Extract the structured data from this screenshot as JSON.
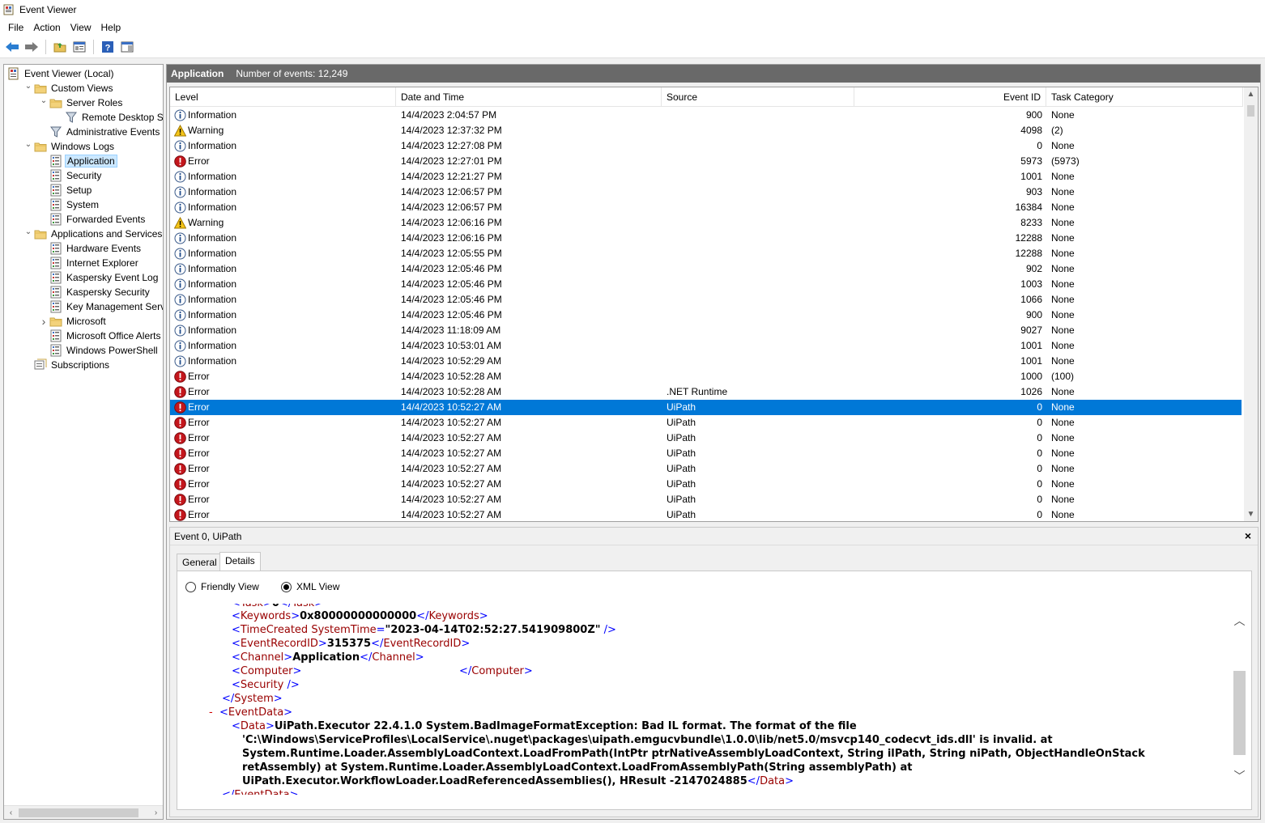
{
  "window": {
    "title": "Event Viewer"
  },
  "menu": [
    "File",
    "Action",
    "View",
    "Help"
  ],
  "toolbar": {
    "buttons": [
      "back-arrow-icon",
      "forward-arrow-icon",
      "open-folder-icon",
      "properties-icon",
      "help-icon",
      "show-hide-pane-icon"
    ]
  },
  "tree": {
    "items": [
      {
        "label": "Event Viewer (Local)",
        "depth": 0,
        "expander": "",
        "icon": "event-viewer-icon"
      },
      {
        "label": "Custom Views",
        "depth": 1,
        "expander": "open",
        "icon": "folder-icon"
      },
      {
        "label": "Server Roles",
        "depth": 2,
        "expander": "open",
        "icon": "folder-icon"
      },
      {
        "label": "Remote Desktop Serv",
        "depth": 3,
        "expander": "",
        "icon": "filter-icon"
      },
      {
        "label": "Administrative Events",
        "depth": 2,
        "expander": "",
        "icon": "filter-icon"
      },
      {
        "label": "Windows Logs",
        "depth": 1,
        "expander": "open",
        "icon": "folder-icon"
      },
      {
        "label": "Application",
        "depth": 2,
        "expander": "",
        "icon": "log-icon",
        "selected": true
      },
      {
        "label": "Security",
        "depth": 2,
        "expander": "",
        "icon": "log-icon"
      },
      {
        "label": "Setup",
        "depth": 2,
        "expander": "",
        "icon": "log-icon"
      },
      {
        "label": "System",
        "depth": 2,
        "expander": "",
        "icon": "log-icon"
      },
      {
        "label": "Forwarded Events",
        "depth": 2,
        "expander": "",
        "icon": "log-icon"
      },
      {
        "label": "Applications and Services Lo",
        "depth": 1,
        "expander": "open",
        "icon": "folder-icon"
      },
      {
        "label": "Hardware Events",
        "depth": 2,
        "expander": "",
        "icon": "log-icon"
      },
      {
        "label": "Internet Explorer",
        "depth": 2,
        "expander": "",
        "icon": "log-icon"
      },
      {
        "label": "Kaspersky Event Log",
        "depth": 2,
        "expander": "",
        "icon": "log-icon"
      },
      {
        "label": "Kaspersky Security",
        "depth": 2,
        "expander": "",
        "icon": "log-icon"
      },
      {
        "label": "Key Management Service",
        "depth": 2,
        "expander": "",
        "icon": "log-icon"
      },
      {
        "label": "Microsoft",
        "depth": 2,
        "expander": "closed",
        "icon": "folder-icon"
      },
      {
        "label": "Microsoft Office Alerts",
        "depth": 2,
        "expander": "",
        "icon": "log-icon"
      },
      {
        "label": "Windows PowerShell",
        "depth": 2,
        "expander": "",
        "icon": "log-icon"
      },
      {
        "label": "Subscriptions",
        "depth": 1,
        "expander": "",
        "icon": "subscriptions-icon"
      }
    ]
  },
  "main": {
    "title": "Application",
    "count_text": "Number of events: 12,249"
  },
  "columns": [
    "Level",
    "Date and Time",
    "Source",
    "Event ID",
    "Task Category"
  ],
  "events": [
    {
      "level": "Information",
      "datetime": "14/4/2023 2:04:57 PM",
      "source": "",
      "id": "900",
      "task": "None"
    },
    {
      "level": "Warning",
      "datetime": "14/4/2023 12:37:32 PM",
      "source": "",
      "id": "4098",
      "task": "(2)"
    },
    {
      "level": "Information",
      "datetime": "14/4/2023 12:27:08 PM",
      "source": "",
      "id": "0",
      "task": "None"
    },
    {
      "level": "Error",
      "datetime": "14/4/2023 12:27:01 PM",
      "source": "",
      "id": "5973",
      "task": "(5973)"
    },
    {
      "level": "Information",
      "datetime": "14/4/2023 12:21:27 PM",
      "source": "",
      "id": "1001",
      "task": "None"
    },
    {
      "level": "Information",
      "datetime": "14/4/2023 12:06:57 PM",
      "source": "",
      "id": "903",
      "task": "None"
    },
    {
      "level": "Information",
      "datetime": "14/4/2023 12:06:57 PM",
      "source": "",
      "id": "16384",
      "task": "None"
    },
    {
      "level": "Warning",
      "datetime": "14/4/2023 12:06:16 PM",
      "source": "",
      "id": "8233",
      "task": "None"
    },
    {
      "level": "Information",
      "datetime": "14/4/2023 12:06:16 PM",
      "source": "",
      "id": "12288",
      "task": "None"
    },
    {
      "level": "Information",
      "datetime": "14/4/2023 12:05:55 PM",
      "source": "",
      "id": "12288",
      "task": "None"
    },
    {
      "level": "Information",
      "datetime": "14/4/2023 12:05:46 PM",
      "source": "",
      "id": "902",
      "task": "None"
    },
    {
      "level": "Information",
      "datetime": "14/4/2023 12:05:46 PM",
      "source": "",
      "id": "1003",
      "task": "None"
    },
    {
      "level": "Information",
      "datetime": "14/4/2023 12:05:46 PM",
      "source": "",
      "id": "1066",
      "task": "None"
    },
    {
      "level": "Information",
      "datetime": "14/4/2023 12:05:46 PM",
      "source": "",
      "id": "900",
      "task": "None"
    },
    {
      "level": "Information",
      "datetime": "14/4/2023 11:18:09 AM",
      "source": "",
      "id": "9027",
      "task": "None"
    },
    {
      "level": "Information",
      "datetime": "14/4/2023 10:53:01 AM",
      "source": "",
      "id": "1001",
      "task": "None"
    },
    {
      "level": "Information",
      "datetime": "14/4/2023 10:52:29 AM",
      "source": "",
      "id": "1001",
      "task": "None"
    },
    {
      "level": "Error",
      "datetime": "14/4/2023 10:52:28 AM",
      "source": "",
      "id": "1000",
      "task": "(100)"
    },
    {
      "level": "Error",
      "datetime": "14/4/2023 10:52:28 AM",
      "source": ".NET Runtime",
      "id": "1026",
      "task": "None"
    },
    {
      "level": "Error",
      "datetime": "14/4/2023 10:52:27 AM",
      "source": "UiPath",
      "id": "0",
      "task": "None",
      "selected": true
    },
    {
      "level": "Error",
      "datetime": "14/4/2023 10:52:27 AM",
      "source": "UiPath",
      "id": "0",
      "task": "None"
    },
    {
      "level": "Error",
      "datetime": "14/4/2023 10:52:27 AM",
      "source": "UiPath",
      "id": "0",
      "task": "None"
    },
    {
      "level": "Error",
      "datetime": "14/4/2023 10:52:27 AM",
      "source": "UiPath",
      "id": "0",
      "task": "None"
    },
    {
      "level": "Error",
      "datetime": "14/4/2023 10:52:27 AM",
      "source": "UiPath",
      "id": "0",
      "task": "None"
    },
    {
      "level": "Error",
      "datetime": "14/4/2023 10:52:27 AM",
      "source": "UiPath",
      "id": "0",
      "task": "None"
    },
    {
      "level": "Error",
      "datetime": "14/4/2023 10:52:27 AM",
      "source": "UiPath",
      "id": "0",
      "task": "None"
    },
    {
      "level": "Error",
      "datetime": "14/4/2023 10:52:27 AM",
      "source": "UiPath",
      "id": "0",
      "task": "None"
    }
  ],
  "detail": {
    "title": "Event 0, UiPath",
    "close": "×",
    "tabs": [
      "General",
      "Details"
    ],
    "active_tab": "Details",
    "radios": [
      {
        "label": "Friendly View",
        "checked": false
      },
      {
        "label": "XML View",
        "checked": true
      }
    ],
    "xml": {
      "keywords_tag": "Keywords",
      "keywords_value": "0x80000000000000",
      "timecreated_tag": "TimeCreated",
      "systemtime_attr": "SystemTime",
      "systemtime_value": "\"2023-04-14T02:52:27.541909800Z\"",
      "recordid_tag": "EventRecordID",
      "recordid_value": "315375",
      "channel_tag": "Channel",
      "channel_value": "Application",
      "computer_tag": "Computer",
      "security_tag": "Security",
      "system_tag": "System",
      "eventdata_tag": "EventData",
      "data_tag": "Data",
      "collapse": "-",
      "data_lines": [
        "UiPath.Executor 22.4.1.0 System.BadImageFormatException: Bad IL format. The format of the file",
        "'C:\\Windows\\ServiceProfiles\\LocalService\\.nuget\\packages\\uipath.emgucvbundle\\1.0.0\\lib/net5.0/msvcp140_codecvt_ids.dll' is invalid. at",
        "System.Runtime.Loader.AssemblyLoadContext.LoadFromPath(IntPtr ptrNativeAssemblyLoadContext, String ilPath, String niPath, ObjectHandleOnStack",
        "retAssembly) at System.Runtime.Loader.AssemblyLoadContext.LoadFromAssemblyPath(String assemblyPath) at",
        "UiPath.Executor.WorkflowLoader.LoadReferencedAssemblies(), HResult -2147024885"
      ]
    }
  },
  "colors": {
    "selection": "#0078d7",
    "header_bar": "#696969",
    "xml_tag": "#0000ff",
    "xml_name": "#990000"
  }
}
